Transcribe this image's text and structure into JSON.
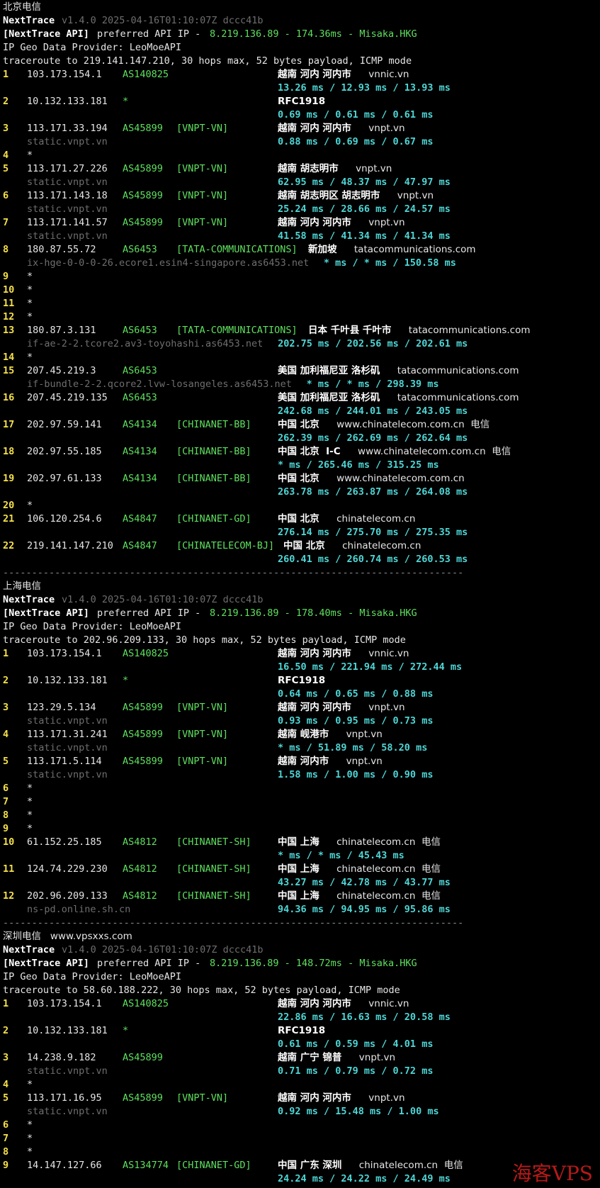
{
  "watermark": "海客VPS",
  "colors": {
    "background": "#000000",
    "hop_number": "#f5e04a",
    "asn": "#5ee05e",
    "latency": "#4fd6d6",
    "hostname": "#6e6e6e",
    "api_ip": "#5ee05e"
  },
  "sections": [
    {
      "title": "北京电信",
      "version_label": "NextTrace",
      "version": "v1.4.0 2025-04-16T01:10:07Z dccc41b",
      "api_prefix": "[NextTrace API]",
      "api_text": "preferred API IP - ",
      "api_ip": "8.219.136.89 - 174.36ms - Misaka.HKG",
      "geo_provider": "IP Geo Data Provider: LeoMoeAPI",
      "trace_line": "traceroute to 219.141.147.210, 30 hops max, 52 bytes payload, ICMP mode",
      "hops": [
        {
          "n": "1",
          "ip": "103.173.154.1",
          "as": "AS140825",
          "net": "",
          "geo": "越南 河内 河内市",
          "domain": "vnnic.vn",
          "host": "",
          "rtt": "13.26 ms / 12.93 ms / 13.93 ms"
        },
        {
          "n": "2",
          "ip": "10.132.133.181",
          "as": "*",
          "net": "",
          "geo": "RFC1918",
          "domain": "",
          "host": "",
          "rtt": "0.69 ms / 0.61 ms / 0.61 ms"
        },
        {
          "n": "3",
          "ip": "113.171.33.194",
          "as": "AS45899",
          "net": "[VNPT-VN]",
          "geo": "越南 河内 河内市",
          "domain": "vnpt.vn",
          "host": "static.vnpt.vn",
          "rtt": "0.88 ms / 0.69 ms / 0.67 ms"
        },
        {
          "n": "4",
          "ip": "*",
          "as": "",
          "net": "",
          "geo": "",
          "domain": "",
          "host": "",
          "rtt": ""
        },
        {
          "n": "5",
          "ip": "113.171.27.226",
          "as": "AS45899",
          "net": "[VNPT-VN]",
          "geo": "越南 胡志明市",
          "domain": "vnpt.vn",
          "host": "static.vnpt.vn",
          "rtt": "62.95 ms / 48.37 ms / 47.97 ms"
        },
        {
          "n": "6",
          "ip": "113.171.143.18",
          "as": "AS45899",
          "net": "[VNPT-VN]",
          "geo": "越南 胡志明区 胡志明市",
          "domain": "vnpt.vn",
          "host": "static.vnpt.vn",
          "rtt": "25.24 ms / 28.66 ms / 24.57 ms"
        },
        {
          "n": "7",
          "ip": "113.171.141.57",
          "as": "AS45899",
          "net": "[VNPT-VN]",
          "geo": "越南 河内 河内市",
          "domain": "vnpt.vn",
          "host": "static.vnpt.vn",
          "rtt": "41.58 ms / 41.34 ms / 41.34 ms"
        },
        {
          "n": "8",
          "ip": "180.87.55.72",
          "as": "AS6453",
          "net": "[TATA-COMMUNICATIONS]",
          "geo": "新加坡",
          "domain": "tatacommunications.com",
          "host": "ix-hge-0-0-0-26.ecore1.esin4-singapore.as6453.net",
          "rtt": "* ms / * ms / 150.58 ms",
          "inline": true
        },
        {
          "n": "9",
          "ip": "*",
          "as": "",
          "net": "",
          "geo": "",
          "domain": "",
          "host": "",
          "rtt": ""
        },
        {
          "n": "10",
          "ip": "*",
          "as": "",
          "net": "",
          "geo": "",
          "domain": "",
          "host": "",
          "rtt": ""
        },
        {
          "n": "11",
          "ip": "*",
          "as": "",
          "net": "",
          "geo": "",
          "domain": "",
          "host": "",
          "rtt": ""
        },
        {
          "n": "12",
          "ip": "*",
          "as": "",
          "net": "",
          "geo": "",
          "domain": "",
          "host": "",
          "rtt": ""
        },
        {
          "n": "13",
          "ip": "180.87.3.131",
          "as": "AS6453",
          "net": "[TATA-COMMUNICATIONS]",
          "geo": "日本 千叶县 千叶市",
          "domain": "tatacommunications.com",
          "host": "if-ae-2-2.tcore2.av3-toyohashi.as6453.net",
          "rtt": "202.75 ms / 202.56 ms / 202.61 ms",
          "inline": true
        },
        {
          "n": "14",
          "ip": "*",
          "as": "",
          "net": "",
          "geo": "",
          "domain": "",
          "host": "",
          "rtt": ""
        },
        {
          "n": "15",
          "ip": "207.45.219.3",
          "as": "AS6453",
          "net": "",
          "geo": "美国 加利福尼亚 洛杉矶",
          "domain": "tatacommunications.com",
          "host": "if-bundle-2-2.qcore2.lvw-losangeles.as6453.net",
          "rtt": "* ms / * ms / 298.39 ms",
          "inline": true
        },
        {
          "n": "16",
          "ip": "207.45.219.135",
          "as": "AS6453",
          "net": "",
          "geo": "美国 加利福尼亚 洛杉矶",
          "domain": "tatacommunications.com",
          "host": "",
          "rtt": "242.68 ms / 244.01 ms / 243.05 ms"
        },
        {
          "n": "17",
          "ip": "202.97.59.141",
          "as": "AS4134",
          "net": "[CHINANET-BB]",
          "geo": "中国 北京",
          "domain": "www.chinatelecom.com.cn  电信",
          "host": "",
          "rtt": "262.39 ms / 262.69 ms / 262.64 ms"
        },
        {
          "n": "18",
          "ip": "202.97.55.185",
          "as": "AS4134",
          "net": "[CHINANET-BB]",
          "geo": "中国 北京  I-C",
          "domain": "www.chinatelecom.com.cn  电信",
          "host": "",
          "rtt": "* ms / 265.46 ms / 315.25 ms"
        },
        {
          "n": "19",
          "ip": "202.97.61.133",
          "as": "AS4134",
          "net": "[CHINANET-BB]",
          "geo": "中国 北京",
          "domain": "www.chinatelecom.com.cn",
          "host": "",
          "rtt": "263.78 ms / 263.87 ms / 264.08 ms"
        },
        {
          "n": "20",
          "ip": "*",
          "as": "",
          "net": "",
          "geo": "",
          "domain": "",
          "host": "",
          "rtt": ""
        },
        {
          "n": "21",
          "ip": "106.120.254.6",
          "as": "AS4847",
          "net": "[CHINANET-GD]",
          "geo": "中国 北京",
          "domain": "chinatelecom.cn",
          "host": "",
          "rtt": "276.14 ms / 275.70 ms / 275.35 ms"
        },
        {
          "n": "22",
          "ip": "219.141.147.210",
          "as": "AS4847",
          "net": "[CHINATELECOM-BJ]",
          "geo": "中国 北京",
          "domain": "chinatelecom.cn",
          "host": "",
          "rtt": "260.41 ms / 260.74 ms / 260.53 ms",
          "wide": true
        }
      ]
    },
    {
      "title": "上海电信",
      "version_label": "NextTrace",
      "version": "v1.4.0 2025-04-16T01:10:07Z dccc41b",
      "api_prefix": "[NextTrace API]",
      "api_text": "preferred API IP - ",
      "api_ip": "8.219.136.89 - 178.40ms - Misaka.HKG",
      "geo_provider": "IP Geo Data Provider: LeoMoeAPI",
      "trace_line": "traceroute to 202.96.209.133, 30 hops max, 52 bytes payload, ICMP mode",
      "hops": [
        {
          "n": "1",
          "ip": "103.173.154.1",
          "as": "AS140825",
          "net": "",
          "geo": "越南 河内 河内市",
          "domain": "vnnic.vn",
          "host": "",
          "rtt": "16.50 ms / 221.94 ms / 272.44 ms"
        },
        {
          "n": "2",
          "ip": "10.132.133.181",
          "as": "*",
          "net": "",
          "geo": "RFC1918",
          "domain": "",
          "host": "",
          "rtt": "0.64 ms / 0.65 ms / 0.88 ms"
        },
        {
          "n": "3",
          "ip": "123.29.5.134",
          "as": "AS45899",
          "net": "[VNPT-VN]",
          "geo": "越南 河内 河内市",
          "domain": "vnpt.vn",
          "host": "static.vnpt.vn",
          "rtt": "0.93 ms / 0.95 ms / 0.73 ms"
        },
        {
          "n": "4",
          "ip": "113.171.31.241",
          "as": "AS45899",
          "net": "[VNPT-VN]",
          "geo": "越南 岘港市",
          "domain": "vnpt.vn",
          "host": "static.vnpt.vn",
          "rtt": "* ms / 51.89 ms / 58.20 ms"
        },
        {
          "n": "5",
          "ip": "113.171.5.114",
          "as": "AS45899",
          "net": "[VNPT-VN]",
          "geo": "越南 河内市",
          "domain": "vnpt.vn",
          "host": "static.vnpt.vn",
          "rtt": "1.58 ms / 1.00 ms / 0.90 ms"
        },
        {
          "n": "6",
          "ip": "*",
          "as": "",
          "net": "",
          "geo": "",
          "domain": "",
          "host": "",
          "rtt": ""
        },
        {
          "n": "7",
          "ip": "*",
          "as": "",
          "net": "",
          "geo": "",
          "domain": "",
          "host": "",
          "rtt": ""
        },
        {
          "n": "8",
          "ip": "*",
          "as": "",
          "net": "",
          "geo": "",
          "domain": "",
          "host": "",
          "rtt": ""
        },
        {
          "n": "9",
          "ip": "*",
          "as": "",
          "net": "",
          "geo": "",
          "domain": "",
          "host": "",
          "rtt": ""
        },
        {
          "n": "10",
          "ip": "61.152.25.185",
          "as": "AS4812",
          "net": "[CHINANET-SH]",
          "geo": "中国 上海",
          "domain": "chinatelecom.cn  电信",
          "host": "",
          "rtt": "* ms / * ms / 45.43 ms"
        },
        {
          "n": "11",
          "ip": "124.74.229.230",
          "as": "AS4812",
          "net": "[CHINANET-SH]",
          "geo": "中国 上海",
          "domain": "chinatelecom.cn  电信",
          "host": "",
          "rtt": "43.27 ms / 42.78 ms / 43.77 ms"
        },
        {
          "n": "12",
          "ip": "202.96.209.133",
          "as": "AS4812",
          "net": "[CHINANET-SH]",
          "geo": "中国 上海",
          "domain": "chinatelecom.cn  电信",
          "host": "ns-pd.online.sh.cn",
          "rtt": "94.36 ms / 94.95 ms / 95.86 ms"
        }
      ]
    },
    {
      "title": "深圳电信   www.vpsxxs.com",
      "version_label": "NextTrace",
      "version": "v1.4.0 2025-04-16T01:10:07Z dccc41b",
      "api_prefix": "[NextTrace API]",
      "api_text": "preferred API IP - ",
      "api_ip": "8.219.136.89 - 148.72ms - Misaka.HKG",
      "geo_provider": "IP Geo Data Provider: LeoMoeAPI",
      "trace_line": "traceroute to 58.60.188.222, 30 hops max, 52 bytes payload, ICMP mode",
      "hops": [
        {
          "n": "1",
          "ip": "103.173.154.1",
          "as": "AS140825",
          "net": "",
          "geo": "越南 河内 河内市",
          "domain": "vnnic.vn",
          "host": "",
          "rtt": "22.86 ms / 16.63 ms / 20.58 ms"
        },
        {
          "n": "2",
          "ip": "10.132.133.181",
          "as": "*",
          "net": "",
          "geo": "RFC1918",
          "domain": "",
          "host": "",
          "rtt": "0.61 ms / 0.59 ms / 4.01 ms"
        },
        {
          "n": "3",
          "ip": "14.238.9.182",
          "as": "AS45899",
          "net": "",
          "geo": "越南 广宁 锦普",
          "domain": "vnpt.vn",
          "host": "static.vnpt.vn",
          "rtt": "0.71 ms / 0.79 ms / 0.72 ms"
        },
        {
          "n": "4",
          "ip": "*",
          "as": "",
          "net": "",
          "geo": "",
          "domain": "",
          "host": "",
          "rtt": ""
        },
        {
          "n": "5",
          "ip": "113.171.16.95",
          "as": "AS45899",
          "net": "[VNPT-VN]",
          "geo": "越南 河内 河内市",
          "domain": "vnpt.vn",
          "host": "static.vnpt.vn",
          "rtt": "0.92 ms / 15.48 ms / 1.00 ms"
        },
        {
          "n": "6",
          "ip": "*",
          "as": "",
          "net": "",
          "geo": "",
          "domain": "",
          "host": "",
          "rtt": ""
        },
        {
          "n": "7",
          "ip": "*",
          "as": "",
          "net": "",
          "geo": "",
          "domain": "",
          "host": "",
          "rtt": ""
        },
        {
          "n": "8",
          "ip": "*",
          "as": "",
          "net": "",
          "geo": "",
          "domain": "",
          "host": "",
          "rtt": ""
        },
        {
          "n": "9",
          "ip": "14.147.127.66",
          "as": "AS134774",
          "net": "[CHINANET-GD]",
          "geo": "中国 广东 深圳",
          "domain": "chinatelecom.cn  电信",
          "host": "",
          "rtt": "24.24 ms / 24.22 ms / 24.49 ms"
        }
      ]
    }
  ],
  "separator": "--------------------------------------------------------------------------------"
}
